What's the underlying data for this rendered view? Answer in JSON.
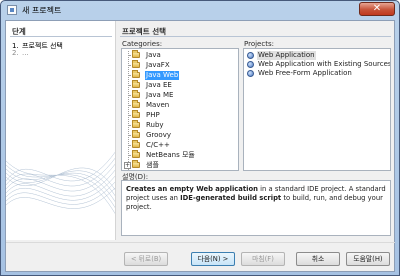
{
  "window": {
    "title": "새 프로젝트",
    "close_glyph": "✕"
  },
  "steps": {
    "title": "단계",
    "items": [
      {
        "num": "1.",
        "label": "프로젝트 선택"
      },
      {
        "num": "2.",
        "label": "..."
      }
    ]
  },
  "main": {
    "title": "프로젝트 선택",
    "categories_label": "Categories:",
    "projects_label": "Projects:",
    "description_label": "설명(D):"
  },
  "categories": [
    {
      "label": "Java",
      "selected": false
    },
    {
      "label": "JavaFX",
      "selected": false
    },
    {
      "label": "Java Web",
      "selected": true
    },
    {
      "label": "Java EE",
      "selected": false
    },
    {
      "label": "Java ME",
      "selected": false
    },
    {
      "label": "Maven",
      "selected": false
    },
    {
      "label": "PHP",
      "selected": false
    },
    {
      "label": "Ruby",
      "selected": false
    },
    {
      "label": "Groovy",
      "selected": false
    },
    {
      "label": "C/C++",
      "selected": false
    },
    {
      "label": "NetBeans 모듈",
      "selected": false
    },
    {
      "label": "샘플",
      "selected": false,
      "expand": "+"
    }
  ],
  "projects": [
    {
      "label": "Web Application",
      "selected": true
    },
    {
      "label": "Web Application with Existing Sources",
      "selected": false
    },
    {
      "label": "Web Free-Form Application",
      "selected": false
    }
  ],
  "description": {
    "p1_bold": "Creates an empty Web application",
    "p2": " in a standard IDE project. A standard project uses an ",
    "p3_bold": "IDE-generated build script",
    "p4": " to build, run, and debug your project."
  },
  "buttons": {
    "back": "< 뒤로(B)",
    "next": "다음(N) >",
    "finish": "마침(F)",
    "cancel": "취소",
    "help": "도움말(H)"
  },
  "colors": {
    "selection": "#3399ff",
    "close_button": "#c75339"
  }
}
